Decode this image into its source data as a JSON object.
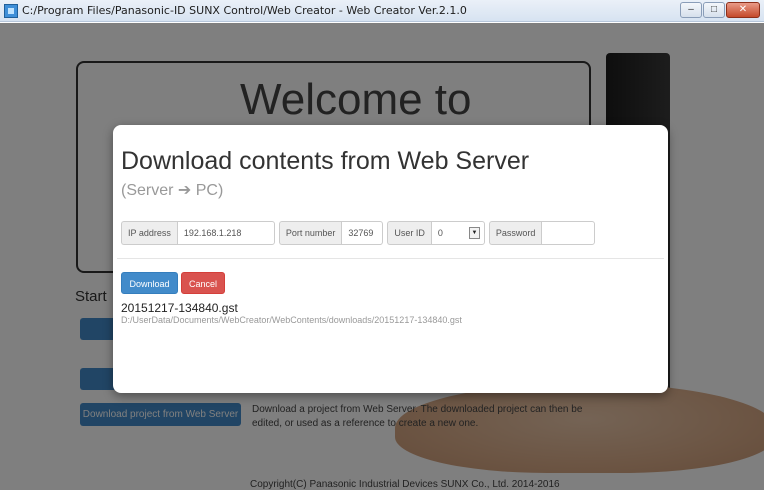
{
  "window": {
    "title": "C:/Program Files/Panasonic-ID SUNX Control/Web Creator - Web Creator Ver.2.1.0",
    "minimize": "–",
    "maximize": "□",
    "close": "✕"
  },
  "background": {
    "hero_title": "Welcome to",
    "start_label": "Start",
    "download_project_button": "Download project from Web Server",
    "download_project_desc": "Download a project from Web Server. The downloaded project can then be edited, or used as a reference to create a new one.",
    "copyright": "Copyright(C) Panasonic Industrial Devices SUNX Co., Ltd. 2014-2016"
  },
  "modal": {
    "title": "Download contents from Web Server",
    "subtitle": "(Server ➔ PC)",
    "fields": {
      "ip_label": "IP address",
      "ip_value": "192.168.1.218",
      "port_label": "Port number",
      "port_value": "32769",
      "user_label": "User ID",
      "user_value": "0",
      "password_label": "Password",
      "password_value": ""
    },
    "buttons": {
      "download": "Download",
      "cancel": "Cancel"
    },
    "file": {
      "name": "20151217-134840.gst",
      "path": "D:/UserData/Documents/WebCreator/WebContents/downloads/20151217-134840.gst"
    }
  },
  "colors": {
    "primary": "#428bca",
    "danger": "#d9534f",
    "overlay": "rgba(0,0,0,0.5)"
  }
}
